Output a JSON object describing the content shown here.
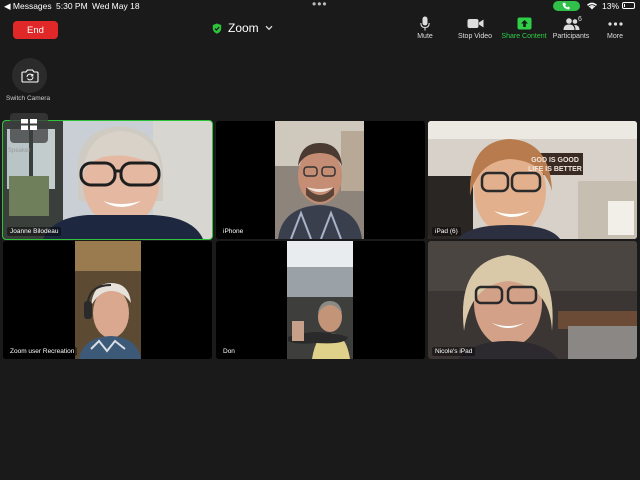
{
  "status_bar": {
    "back_label": "◀ Messages",
    "time": "5:30 PM",
    "date": "Wed May 18",
    "battery": "13%",
    "battery_level": 0.13
  },
  "meeting": {
    "end_label": "End",
    "title": "Zoom",
    "encryption_icon": "shield-check-icon"
  },
  "toolbar": {
    "mute_label": "Mute",
    "stop_video_label": "Stop Video",
    "share_label": "Share Content",
    "participants_label": "Participants",
    "participants_count": "6",
    "more_label": "More"
  },
  "switch_camera_label": "Switch Camera",
  "speaker_view_label": "Speaker",
  "colors": {
    "end_red": "#e02828",
    "share_green": "#2fce47",
    "active_speaker_border": "#2dc43a",
    "background": "#1a1a1a"
  },
  "participants": [
    {
      "name": "Joanne Bilodeau",
      "active": true
    },
    {
      "name": "iPhone",
      "active": false
    },
    {
      "name": "iPad (6)",
      "active": false
    },
    {
      "name": "Zoom user Recreation",
      "active": false
    },
    {
      "name": "Don",
      "active": false
    },
    {
      "name": "Nicole's iPad",
      "active": false
    }
  ],
  "sign_text": "GOD IS GOOD\nLIFE IS BETTER"
}
